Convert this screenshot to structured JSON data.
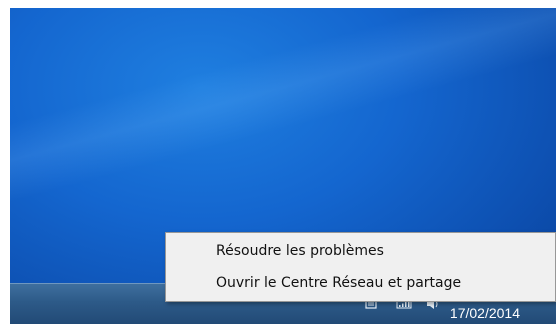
{
  "context_menu": {
    "items": [
      {
        "label": "Résoudre les problèmes"
      },
      {
        "label": "Ouvrir le Centre Réseau et partage"
      }
    ]
  },
  "taskbar": {
    "clock": {
      "date": "17/02/2014"
    },
    "tray_icons": [
      "action-center-icon",
      "network-icon",
      "volume-icon"
    ]
  },
  "colors": {
    "desktop": "#1466cf",
    "taskbar": "#2d5a88",
    "menu_background": "#f0f0f0",
    "menu_border": "#979797"
  }
}
